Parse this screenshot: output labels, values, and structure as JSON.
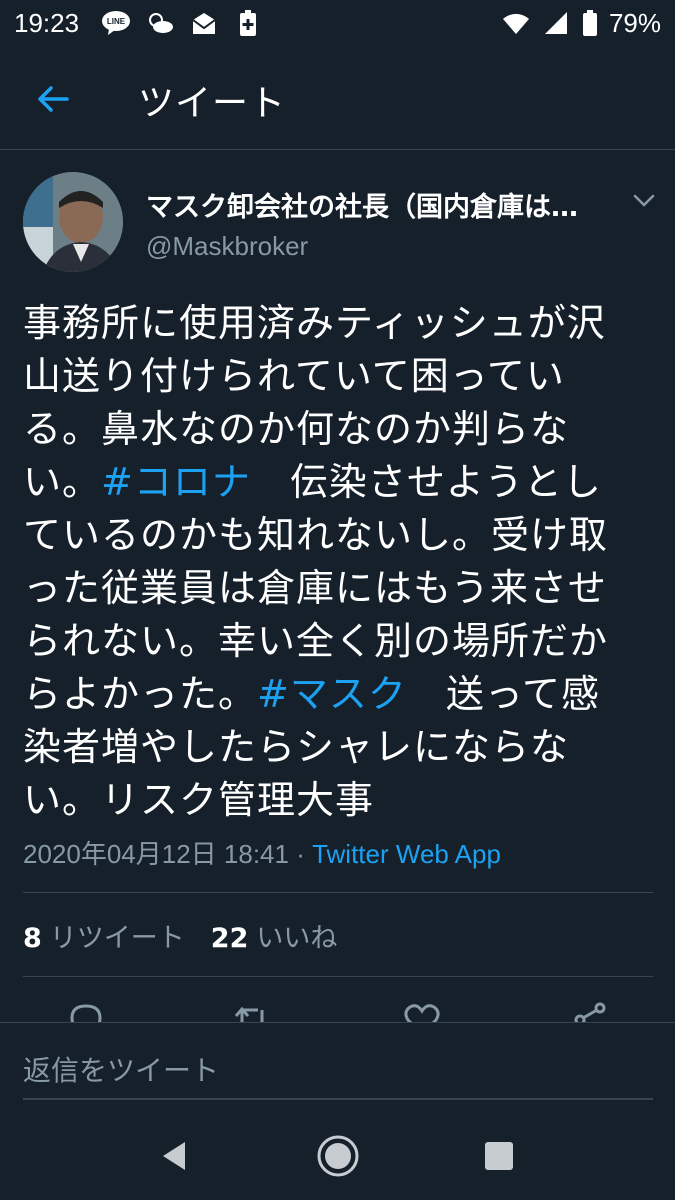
{
  "status_bar": {
    "time": "19:23",
    "line_label": "LINE",
    "battery": "79%"
  },
  "header": {
    "title": "ツイート"
  },
  "tweet": {
    "author_name": "マスク卸会社の社長（国内倉庫は…",
    "author_handle": "@Maskbroker",
    "lines": [
      [
        {
          "t": "事務所に使用済みティッシュが沢",
          "h": false
        }
      ],
      [
        {
          "t": "山送り付けられていて困ってい",
          "h": false
        }
      ],
      [
        {
          "t": "る。鼻水なのか何なのか判らな",
          "h": false
        }
      ],
      [
        {
          "t": "い。",
          "h": false
        },
        {
          "t": "#コロナ",
          "h": true
        },
        {
          "t": "　伝染させようとし",
          "h": false
        }
      ],
      [
        {
          "t": "ているのかも知れないし。受け取",
          "h": false
        }
      ],
      [
        {
          "t": "った従業員は倉庫にはもう来させ",
          "h": false
        }
      ],
      [
        {
          "t": "られない。幸い全く別の場所だか",
          "h": false
        }
      ],
      [
        {
          "t": "らよかった。",
          "h": false
        },
        {
          "t": "#マスク",
          "h": true
        },
        {
          "t": "　送って感",
          "h": false
        }
      ],
      [
        {
          "t": "染者増やしたらシャレにならな",
          "h": false
        }
      ],
      [
        {
          "t": "い。リスク管理大事",
          "h": false
        }
      ]
    ],
    "timestamp": "2020年04月12日 18:41",
    "separator": " · ",
    "source": "Twitter Web App",
    "retweet_count": "8",
    "retweet_label": "リツイート",
    "like_count": "22",
    "like_label": "いいね"
  },
  "reply": {
    "placeholder": "返信をツイート"
  },
  "colors": {
    "background": "#15202b",
    "accent": "#1da1f2",
    "secondary_text": "#8899a6",
    "divider": "#38444d"
  },
  "icons": {
    "back": "arrow-left-icon",
    "caret": "chevron-down-icon",
    "reply": "comment-icon",
    "retweet": "retweet-icon",
    "like": "heart-icon",
    "share": "share-icon"
  }
}
